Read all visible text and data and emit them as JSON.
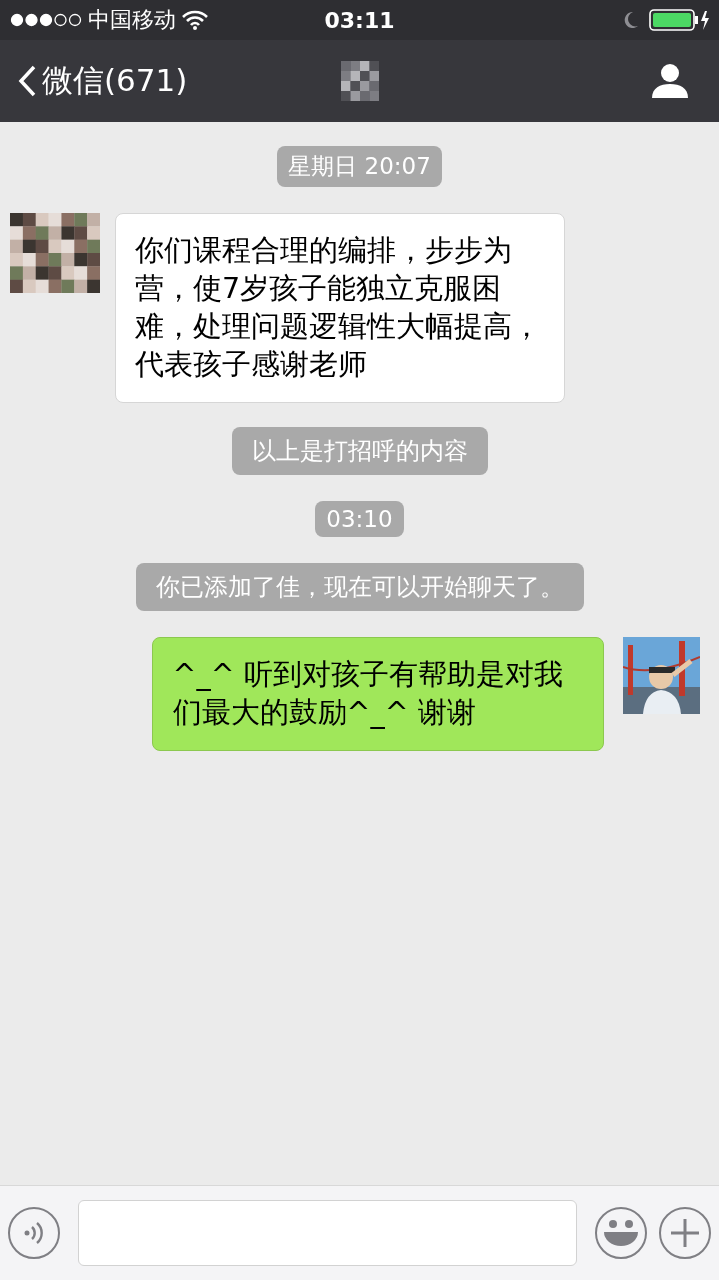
{
  "status_bar": {
    "carrier": "中国移动",
    "time": "03:11"
  },
  "nav_bar": {
    "back_label": "微信(671)"
  },
  "messages": [
    {
      "kind": "time",
      "text": "星期日 20:07"
    },
    {
      "kind": "incoming",
      "text": "你们课程合理的编排，步步为营，使7岁孩子能独立克服困难，处理问题逻辑性大幅提高，代表孩子感谢老师"
    },
    {
      "kind": "system",
      "text": "以上是打招呼的内容"
    },
    {
      "kind": "time",
      "text": "03:10"
    },
    {
      "kind": "system",
      "text": "你已添加了佳，现在可以开始聊天了。"
    },
    {
      "kind": "outgoing",
      "text": "^_^ 听到对孩子有帮助是对我们最大的鼓励^_^ 谢谢"
    }
  ]
}
